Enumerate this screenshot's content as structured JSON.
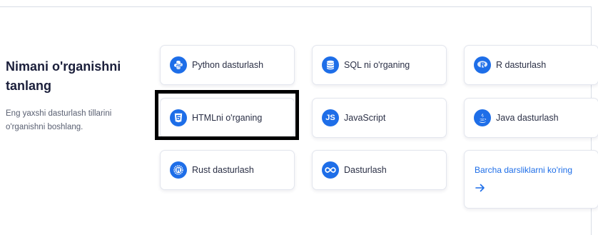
{
  "intro": {
    "title": "Nimani o'rganishni tanlang",
    "description": "Eng yaxshi dasturlash tillarini o'rganishni boshlang."
  },
  "courses": [
    {
      "label": "Python dasturlash",
      "icon": "python-icon"
    },
    {
      "label": "SQL ni o'rganing",
      "icon": "database-icon"
    },
    {
      "label": "R dasturlash",
      "icon": "r-icon"
    },
    {
      "label": "HTMLni o'rganing",
      "icon": "html5-icon"
    },
    {
      "label": "JavaScript",
      "icon": "js-icon"
    },
    {
      "label": "Java dasturlash",
      "icon": "java-icon"
    },
    {
      "label": "Rust dasturlash",
      "icon": "rust-icon"
    },
    {
      "label": "Dasturlash",
      "icon": "infinity-icon"
    }
  ],
  "all_courses": {
    "label": "Barcha darsliklarni ko'ring",
    "icon": "arrow-right-icon"
  },
  "colors": {
    "accent": "#1e6ee8",
    "heading": "#1b1f3b",
    "highlight_border": "#000000"
  }
}
